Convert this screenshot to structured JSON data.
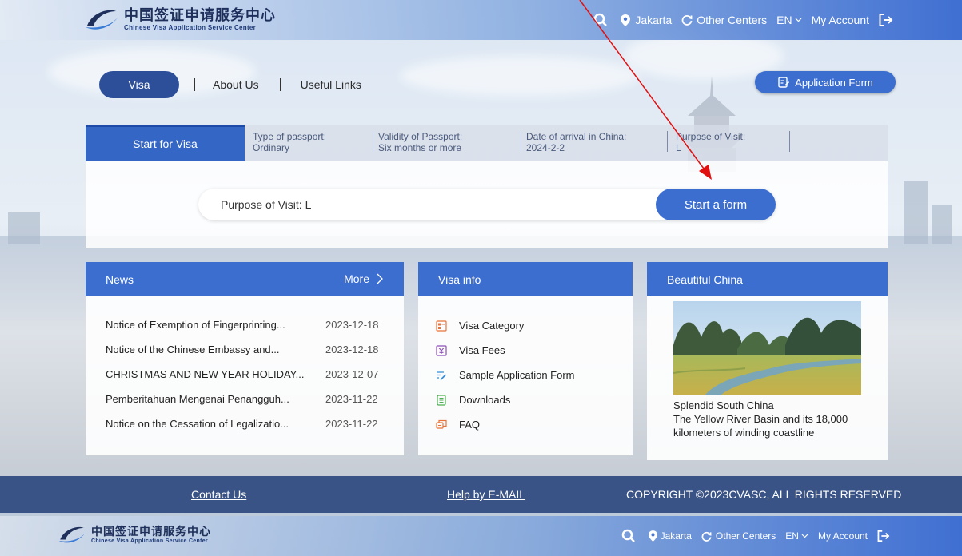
{
  "header": {
    "logo_cn": "中国签证申请服务中心",
    "logo_en": "Chinese Visa Application Service Center",
    "search_icon": "search-icon",
    "location": "Jakarta",
    "other_centers": "Other Centers",
    "language": "EN",
    "account": "My Account",
    "logout_icon": "logout-icon"
  },
  "nav": {
    "visa": "Visa",
    "about": "About Us",
    "links": "Useful Links",
    "application_form": "Application Form"
  },
  "visa_panel": {
    "tab": "Start for Visa",
    "fields": [
      {
        "label": "Type of passport:",
        "value": "Ordinary"
      },
      {
        "label": "Validity of Passport:",
        "value": "Six months or more"
      },
      {
        "label": "Date of arrival in China:",
        "value": "2024-2-2"
      },
      {
        "label": "Purpose of Visit:",
        "value": "L"
      }
    ],
    "search_value": "Purpose of Visit: L",
    "start_button": "Start a form"
  },
  "news": {
    "title": "News",
    "more": "More",
    "items": [
      {
        "title": "Notice of Exemption of Fingerprinting...",
        "date": "2023-12-18"
      },
      {
        "title": "Notice of the Chinese Embassy and...",
        "date": "2023-12-18"
      },
      {
        "title": "CHRISTMAS AND NEW YEAR HOLIDAY...",
        "date": "2023-12-07"
      },
      {
        "title": "Pemberitahuan Mengenai Penangguh...",
        "date": "2023-11-22"
      },
      {
        "title": "Notice on the Cessation of Legalizatio...",
        "date": "2023-11-22"
      }
    ]
  },
  "visa_info": {
    "title": "Visa info",
    "items": [
      {
        "label": "Visa Category",
        "icon": "category-icon"
      },
      {
        "label": "Visa Fees",
        "icon": "fees-icon"
      },
      {
        "label": "Sample Application Form",
        "icon": "sample-form-icon"
      },
      {
        "label": "Downloads",
        "icon": "downloads-icon"
      },
      {
        "label": "FAQ",
        "icon": "faq-icon"
      }
    ]
  },
  "beautiful_china": {
    "title": "Beautiful China",
    "line1": "Splendid South China",
    "line2": "The Yellow River Basin and its 18,000 kilometers of winding coastline"
  },
  "footer": {
    "contact": "Contact Us",
    "help": "Help by E-MAIL",
    "copyright": "COPYRIGHT ©2023CVASC, ALL RIGHTS RESERVED"
  },
  "colors": {
    "primary": "#3c6ed0",
    "nav_pill": "#2d4f9a",
    "footer": "#3a5386",
    "annotation_arrow": "#e01010"
  }
}
